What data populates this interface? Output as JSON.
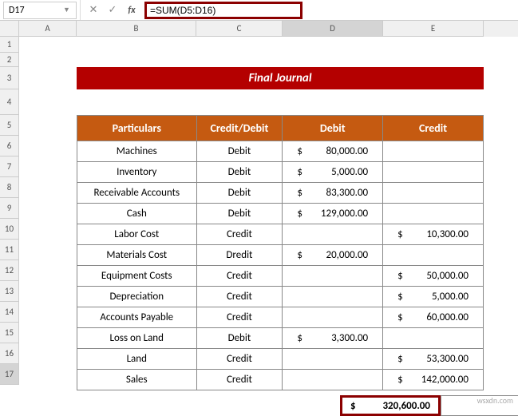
{
  "formula_bar": {
    "cell_ref": "D17",
    "formula": "=SUM(D5:D16)"
  },
  "columns": [
    "A",
    "B",
    "C",
    "D",
    "E"
  ],
  "row_numbers": [
    "1",
    "2",
    "3",
    "4",
    "5",
    "6",
    "7",
    "8",
    "9",
    "10",
    "11",
    "12",
    "13",
    "14",
    "15",
    "16",
    "17"
  ],
  "title": "Final Journal",
  "headers": {
    "particulars": "Particulars",
    "cd": "Credit/Debit",
    "debit": "Debit",
    "credit": "Credit"
  },
  "rows": [
    {
      "p": "Machines",
      "cd": "Debit",
      "debit": "80,000.00",
      "credit": ""
    },
    {
      "p": "Inventory",
      "cd": "Debit",
      "debit": "5,000.00",
      "credit": ""
    },
    {
      "p": "Receivable Accounts",
      "cd": "Debit",
      "debit": "83,300.00",
      "credit": ""
    },
    {
      "p": "Cash",
      "cd": "Debit",
      "debit": "129,000.00",
      "credit": ""
    },
    {
      "p": "Labor Cost",
      "cd": "Credit",
      "debit": "",
      "credit": "10,300.00"
    },
    {
      "p": "Materials Cost",
      "cd": "Dredit",
      "debit": "20,000.00",
      "credit": ""
    },
    {
      "p": "Equipment Costs",
      "cd": "Credit",
      "debit": "",
      "credit": "50,000.00"
    },
    {
      "p": "Depreciation",
      "cd": "Credit",
      "debit": "",
      "credit": "5,000.00"
    },
    {
      "p": "Accounts Payable",
      "cd": "Credit",
      "debit": "",
      "credit": "60,000.00"
    },
    {
      "p": "Loss on Land",
      "cd": "Debit",
      "debit": "3,300.00",
      "credit": ""
    },
    {
      "p": "Land",
      "cd": "Credit",
      "debit": "",
      "credit": "53,300.00"
    },
    {
      "p": "Sales",
      "cd": "Credit",
      "debit": "",
      "credit": "142,000.00"
    }
  ],
  "total": {
    "sym": "$",
    "value": "320,600.00"
  },
  "currency": "$",
  "watermark": "wsxdn.com"
}
